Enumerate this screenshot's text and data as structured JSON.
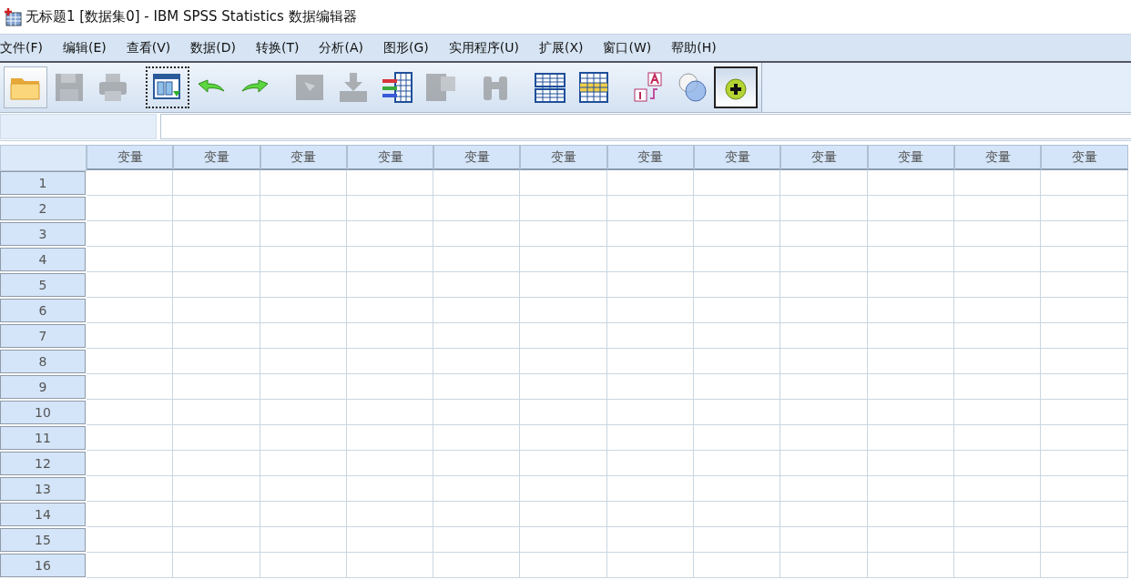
{
  "window": {
    "title": "无标题1 [数据集0] - IBM SPSS Statistics 数据编辑器"
  },
  "menu": [
    "文件(F)",
    "编辑(E)",
    "查看(V)",
    "数据(D)",
    "转换(T)",
    "分析(A)",
    "图形(G)",
    "实用程序(U)",
    "扩展(X)",
    "窗口(W)",
    "帮助(H)"
  ],
  "toolbar": [
    [
      {
        "kind": "open",
        "disabled": false,
        "hover": true,
        "focused": false,
        "pressed": false
      },
      {
        "kind": "save",
        "disabled": true,
        "hover": false,
        "focused": false,
        "pressed": false
      },
      {
        "kind": "print",
        "disabled": true,
        "hover": false,
        "focused": false,
        "pressed": false
      }
    ],
    [
      {
        "kind": "recall",
        "disabled": false,
        "hover": false,
        "focused": true,
        "pressed": false
      },
      {
        "kind": "undo",
        "disabled": false,
        "hover": false,
        "focused": false,
        "pressed": false
      },
      {
        "kind": "redo",
        "disabled": false,
        "hover": false,
        "focused": false,
        "pressed": false
      }
    ],
    [
      {
        "kind": "gotocase",
        "disabled": true,
        "hover": false,
        "focused": false,
        "pressed": false
      },
      {
        "kind": "gotovar",
        "disabled": true,
        "hover": false,
        "focused": false,
        "pressed": false
      },
      {
        "kind": "variables",
        "disabled": false,
        "hover": false,
        "focused": false,
        "pressed": false
      },
      {
        "kind": "statistics",
        "disabled": true,
        "hover": false,
        "focused": false,
        "pressed": false
      }
    ],
    [
      {
        "kind": "find",
        "disabled": true,
        "hover": false,
        "focused": false,
        "pressed": false
      }
    ],
    [
      {
        "kind": "insertcase",
        "disabled": false,
        "hover": false,
        "focused": false,
        "pressed": false
      },
      {
        "kind": "insertvar",
        "disabled": false,
        "hover": false,
        "focused": false,
        "pressed": false
      }
    ],
    [
      {
        "kind": "labels",
        "disabled": false,
        "hover": false,
        "focused": false,
        "pressed": false
      },
      {
        "kind": "sets",
        "disabled": false,
        "hover": false,
        "focused": false,
        "pressed": false
      },
      {
        "kind": "addon",
        "disabled": false,
        "hover": false,
        "focused": false,
        "pressed": true
      }
    ]
  ],
  "grid": {
    "columns": [
      "变量",
      "变量",
      "变量",
      "变量",
      "变量",
      "变量",
      "变量",
      "变量",
      "变量",
      "变量",
      "变量",
      "变量"
    ],
    "rows": [
      "1",
      "2",
      "3",
      "4",
      "5",
      "6",
      "7",
      "8",
      "9",
      "10",
      "11",
      "12",
      "13",
      "14",
      "15",
      "16"
    ]
  }
}
